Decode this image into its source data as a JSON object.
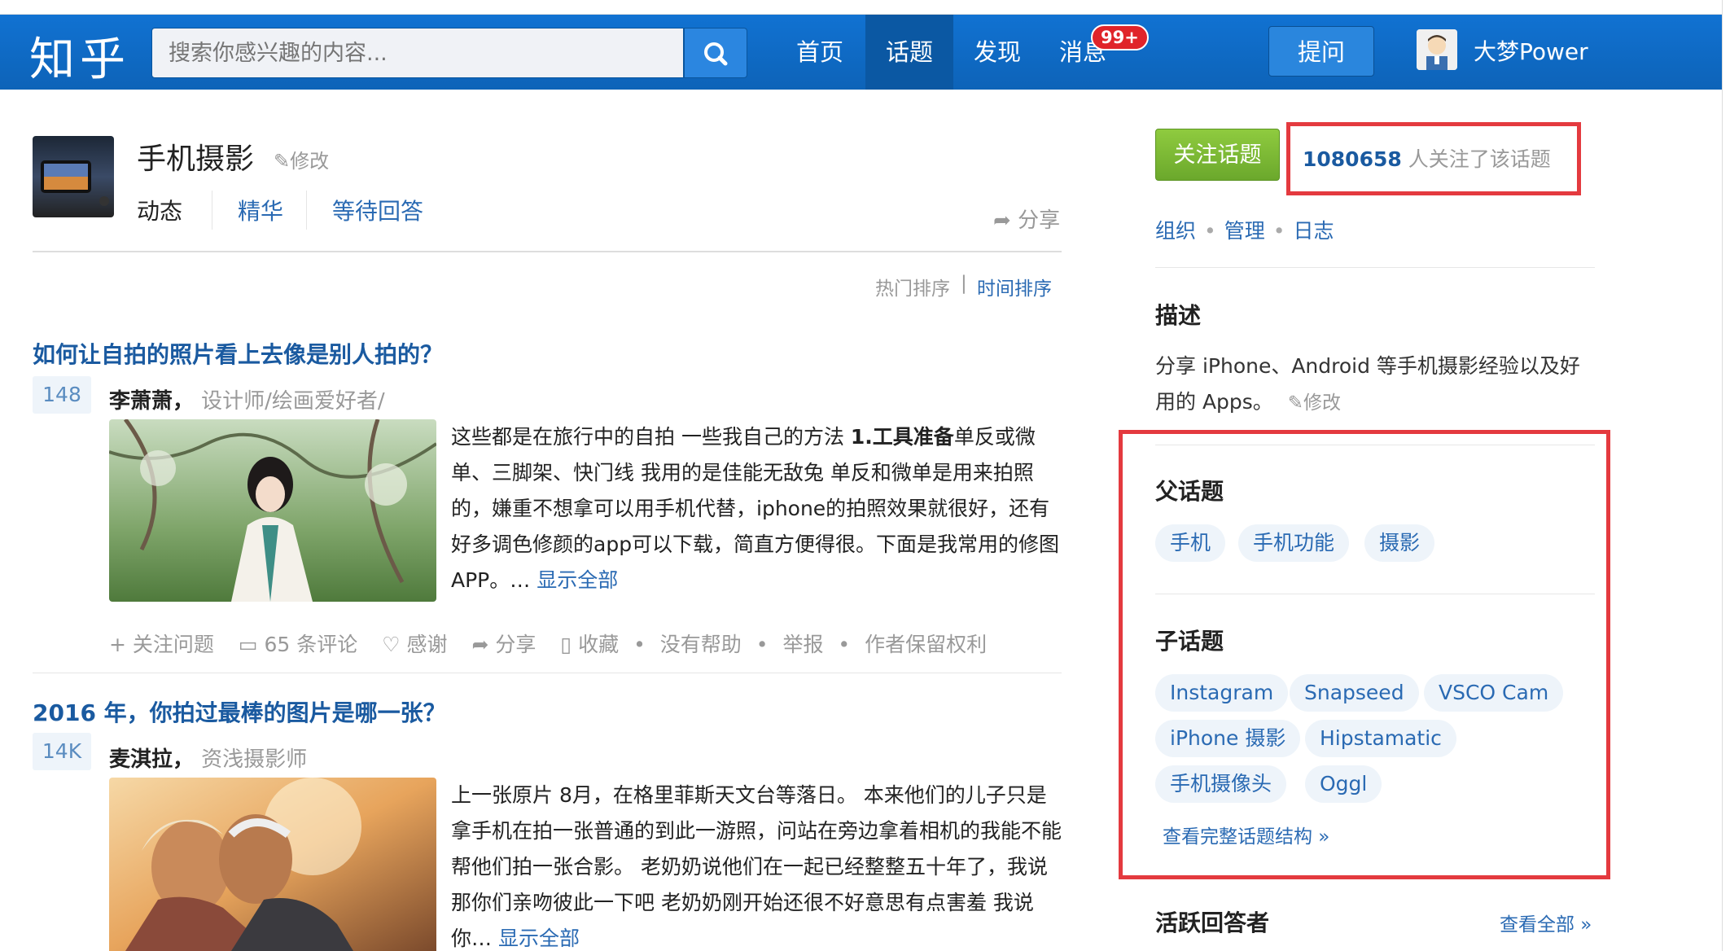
{
  "header": {
    "logo": "知乎",
    "search_placeholder": "搜索你感兴趣的内容...",
    "nav": [
      "首页",
      "话题",
      "发现",
      "消息"
    ],
    "badge": "99+",
    "ask_label": "提问",
    "username": "大梦Power"
  },
  "topic": {
    "title": "手机摄影",
    "edit_label": "修改",
    "tabs": [
      "动态",
      "精华",
      "等待回答"
    ],
    "share_label": "分享",
    "sort_hot": "热门排序",
    "sort_sep": "|",
    "sort_time": "时间排序"
  },
  "feed": [
    {
      "title": "如何让自拍的照片看上去像是别人拍的？",
      "votes": "148",
      "author": "李萧萧，",
      "bio": "设计师/绘画爱好者/",
      "excerpt_pre": "这些都是在旅行中的自拍 一些我自己的方法 ",
      "excerpt_bold": "1.工具准备",
      "excerpt_post": "单反或微单、三脚架、快门线 我用的是佳能无敌兔 单反和微单是用来拍照的，嫌重不想拿可以用手机代替，iphone的拍照效果就很好，还有好多调色修颜的app可以下载，简直方便得很。下面是我常用的修图APP。…",
      "show_all": "显示全部",
      "meta": [
        "+ 关注问题",
        "65 条评论",
        "感谢",
        "分享",
        "收藏",
        "没有帮助",
        "举报",
        "作者保留权利"
      ]
    },
    {
      "title": "2016 年，你拍过最棒的图片是哪一张？",
      "votes": "14K",
      "author": "麦淇拉，",
      "bio": "资浅摄影师",
      "excerpt": "上一张原片 8月，在格里菲斯天文台等落日。 本来他们的儿子只是拿手机在拍一张普通的到此一游照，问站在旁边拿着相机的我能不能帮他们拍一张合影。 老奶奶说他们在一起已经整整五十年了，我说那你们亲吻彼此一下吧 老奶奶刚开始还很不好意思有点害羞 我说你…",
      "show_all": "显示全部"
    }
  ],
  "sidebar": {
    "follow_label": "关注话题",
    "followers_count": "1080658",
    "followers_text": "人关注了该话题",
    "links": [
      "组织",
      "管理",
      "日志"
    ],
    "link_sep": "•",
    "desc_title": "描述",
    "desc_text": "分享 iPhone、Android 等手机摄影经验以及好用的 Apps。",
    "desc_edit": "修改",
    "parent_title": "父话题",
    "parent_tags": [
      "手机",
      "手机功能",
      "摄影"
    ],
    "child_title": "子话题",
    "child_tags": [
      "Instagram",
      "Snapseed",
      "VSCO Cam",
      "iPhone 摄影",
      "Hipstamatic",
      "手机摄像头",
      "Oggl"
    ],
    "view_structure": "查看完整话题结构 »",
    "active_title": "活跃回答者",
    "view_all": "查看全部 »"
  },
  "colors": {
    "header_blue": "#0f6cc6",
    "link_blue": "#2a6ab3",
    "follow_green": "#7bb934",
    "annotation_red": "#e43a3f",
    "badge_red": "#e0242a"
  },
  "icons": [
    "search-icon",
    "pencil-icon",
    "share-icon",
    "comment-icon",
    "heart-icon",
    "bookmark-icon"
  ]
}
